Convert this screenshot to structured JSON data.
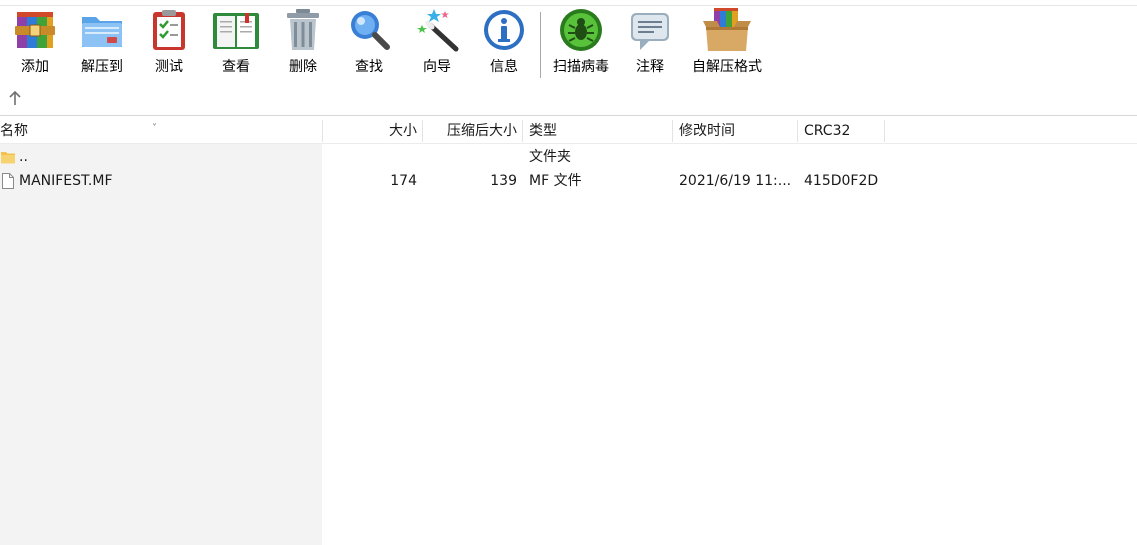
{
  "toolbar": {
    "buttons": [
      {
        "label": "添加",
        "icon": "archive-add-icon"
      },
      {
        "label": "解压到",
        "icon": "extract-folder-icon"
      },
      {
        "label": "测试",
        "icon": "test-checklist-icon"
      },
      {
        "label": "查看",
        "icon": "view-book-icon"
      },
      {
        "label": "删除",
        "icon": "trash-can-icon"
      },
      {
        "label": "查找",
        "icon": "magnifier-icon"
      },
      {
        "label": "向导",
        "icon": "wizard-wand-icon"
      },
      {
        "label": "信息",
        "icon": "info-icon"
      },
      {
        "label": "扫描病毒",
        "icon": "virus-scan-icon"
      },
      {
        "label": "注释",
        "icon": "comment-icon"
      },
      {
        "label": "自解压格式",
        "icon": "sfx-box-icon"
      }
    ]
  },
  "columns": {
    "name": "名称",
    "size": "大小",
    "packed": "压缩后大小",
    "type": "类型",
    "modified": "修改时间",
    "crc": "CRC32"
  },
  "rows": [
    {
      "name": "..",
      "size": "",
      "packed": "",
      "type": "文件夹",
      "modified": "",
      "crc": "",
      "kind": "folder"
    },
    {
      "name": "MANIFEST.MF",
      "size": "174",
      "packed": "139",
      "type": "MF 文件",
      "modified": "2021/6/19 11:...",
      "crc": "415D0F2D",
      "kind": "file"
    }
  ],
  "colors": {
    "folder": "#f2c14e",
    "accent_blue": "#2d7fd3",
    "scan_green": "#3fae2a"
  }
}
